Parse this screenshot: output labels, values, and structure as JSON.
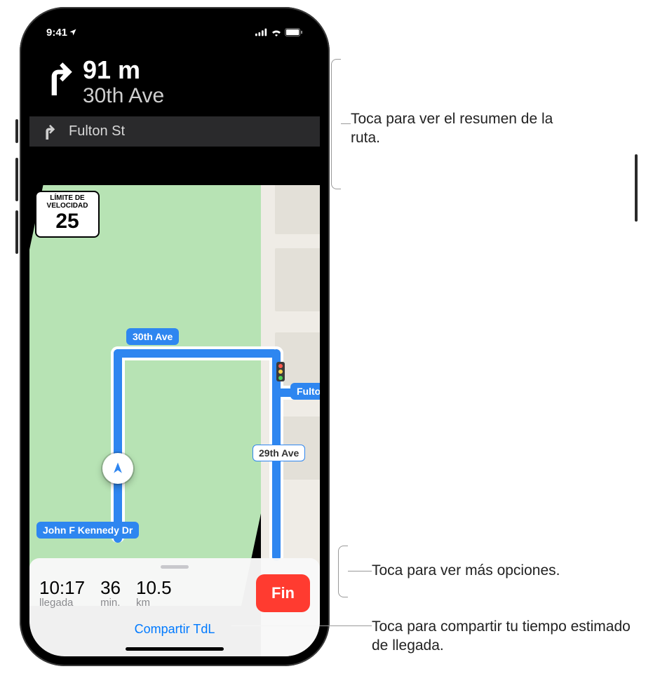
{
  "status": {
    "time": "9:41"
  },
  "direction": {
    "distance": "91 m",
    "street": "30th Ave",
    "next_street": "Fulton St"
  },
  "speed_limit": {
    "label_line1": "LÍMITE DE",
    "label_line2": "VELOCIDAD",
    "value": "25"
  },
  "map_labels": {
    "street_a": "30th Ave",
    "street_b": "Fulton",
    "street_c": "29th Ave",
    "street_d": "John F Kennedy Dr"
  },
  "eta": {
    "arrival_time": "10:17",
    "arrival_label": "llegada",
    "duration_value": "36",
    "duration_label": "min.",
    "distance_value": "10.5",
    "distance_label": "km",
    "end_button": "Fin",
    "share_label": "Compartir TdL"
  },
  "callouts": {
    "route_summary": "Toca para ver el resumen de la ruta.",
    "more_options": "Toca para ver más opciones.",
    "share_eta": "Toca para compartir tu tiempo estimado de llegada."
  }
}
